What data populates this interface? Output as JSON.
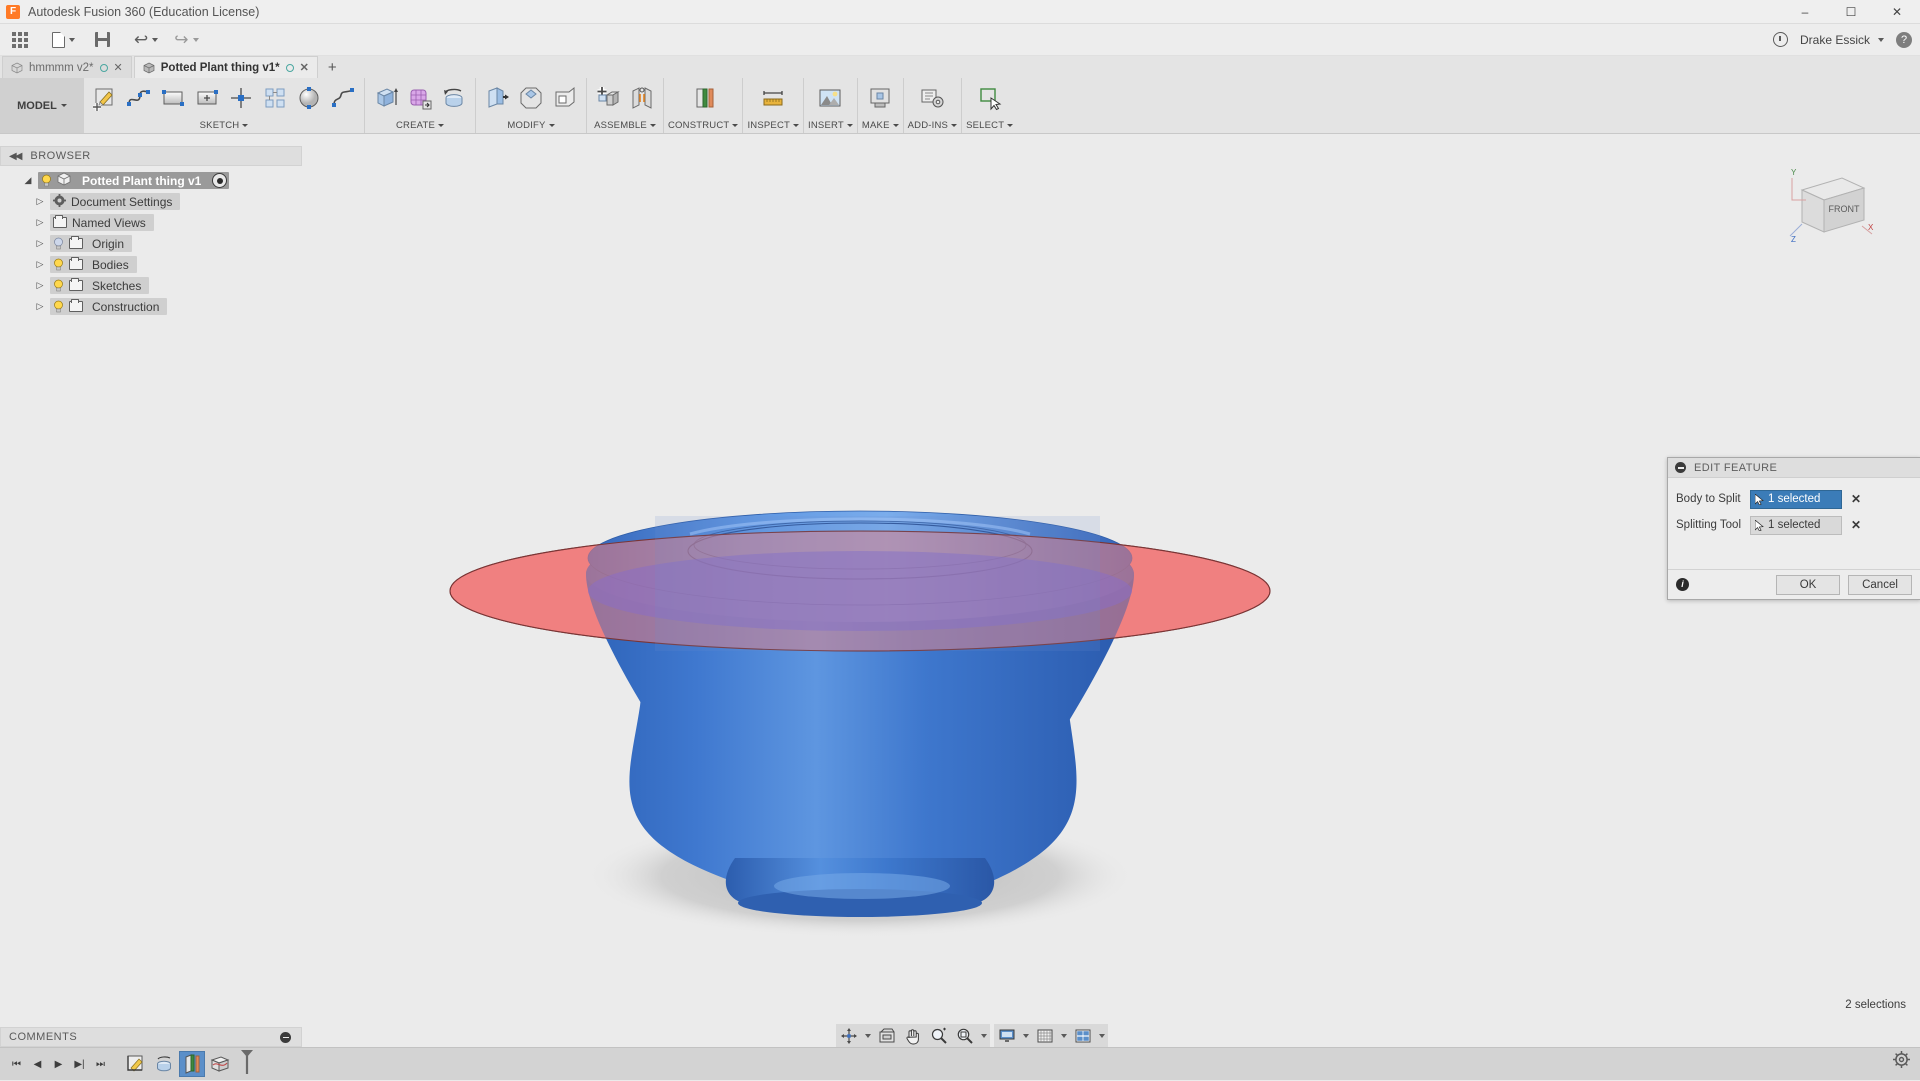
{
  "window": {
    "title": "Autodesk Fusion 360 (Education License)",
    "logo_letter": "F",
    "minimize": "–",
    "maximize": "☐",
    "close": "✕"
  },
  "quick_access": {
    "items": [
      {
        "name": "app-grid-button",
        "label": ""
      },
      {
        "name": "new-file-button",
        "label": ""
      },
      {
        "name": "save-button",
        "label": ""
      },
      {
        "name": "undo-button",
        "label": ""
      },
      {
        "name": "redo-button",
        "label": ""
      }
    ],
    "account_name": "Drake Essick",
    "help_label": "?",
    "recent_label": ""
  },
  "tabs": [
    {
      "label": "hmmmm v2*",
      "active": false,
      "close": "✕"
    },
    {
      "label": "Potted Plant thing v1*",
      "active": true,
      "close": "✕"
    }
  ],
  "new_tab_label": "+",
  "ribbon": {
    "workspace": "MODEL",
    "panels": [
      {
        "label": "SKETCH",
        "has_caret": true,
        "buttons": [
          "create-sketch-icon",
          "spline-icon",
          "rectangle-icon",
          "rectangle-point-icon",
          "construction-line-icon",
          "rectangular-pattern-icon",
          "circle-icon",
          "fit-point-spline-icon"
        ]
      },
      {
        "label": "CREATE",
        "has_caret": true,
        "buttons": [
          "extrude-icon",
          "form-icon",
          "revolve-icon"
        ]
      },
      {
        "label": "MODIFY",
        "has_caret": true,
        "buttons": [
          "press-pull-icon",
          "chamfer-icon",
          "shell-icon"
        ]
      },
      {
        "label": "ASSEMBLE",
        "has_caret": true,
        "buttons": [
          "new-component-icon",
          "joint-icon"
        ]
      },
      {
        "label": "CONSTRUCT",
        "has_caret": true,
        "buttons": [
          "offset-plane-icon"
        ]
      },
      {
        "label": "INSPECT",
        "has_caret": true,
        "buttons": [
          "measure-icon"
        ]
      },
      {
        "label": "INSERT",
        "has_caret": true,
        "buttons": [
          "insert-image-icon"
        ]
      },
      {
        "label": "MAKE",
        "has_caret": true,
        "buttons": [
          "3d-print-icon"
        ]
      },
      {
        "label": "ADD-INS",
        "has_caret": true,
        "buttons": [
          "scripts-addins-icon"
        ]
      },
      {
        "label": "SELECT",
        "has_caret": true,
        "buttons": [
          "select-icon"
        ]
      }
    ]
  },
  "browser": {
    "header": "BROWSER",
    "root": {
      "label": "Potted Plant thing v1",
      "visible": true
    },
    "items": [
      {
        "label": "Document Settings",
        "icon": "gear-icon",
        "has_bulb": false
      },
      {
        "label": "Named Views",
        "icon": "folder-icon",
        "has_bulb": false
      },
      {
        "label": "Origin",
        "icon": "folder-icon",
        "has_bulb": true,
        "bulb_on": false
      },
      {
        "label": "Bodies",
        "icon": "folder-icon",
        "has_bulb": true,
        "bulb_on": true
      },
      {
        "label": "Sketches",
        "icon": "folder-icon",
        "has_bulb": true,
        "bulb_on": true
      },
      {
        "label": "Construction",
        "icon": "folder-icon",
        "has_bulb": true,
        "bulb_on": true
      }
    ]
  },
  "viewcube": {
    "face_label": "FRONT",
    "axis_x": "X",
    "axis_y": "Y",
    "axis_z": "Z"
  },
  "dialog": {
    "title": "EDIT FEATURE",
    "rows": [
      {
        "label": "Body to Split",
        "value": "1 selected",
        "active": true,
        "clear": "✕"
      },
      {
        "label": "Splitting Tool",
        "value": "1 selected",
        "active": false,
        "clear": "✕"
      }
    ],
    "info_glyph": "i",
    "ok_label": "OK",
    "cancel_label": "Cancel"
  },
  "navbar": {
    "buttons": [
      "orbit-icon",
      "look-at-icon",
      "pan-icon",
      "zoom-icon",
      "fit-icon"
    ],
    "display_buttons": [
      "display-settings-icon",
      "grid-snap-icon",
      "viewports-icon"
    ]
  },
  "comments": {
    "header": "COMMENTS"
  },
  "status": {
    "selection_count": "2 selections"
  },
  "timeline": {
    "controls": [
      "go-to-beginning-icon",
      "step-back-icon",
      "play-icon",
      "step-forward-icon",
      "go-to-end-icon"
    ],
    "features": [
      {
        "name": "sketch-feature",
        "selected": false
      },
      {
        "name": "revolve-feature",
        "selected": false
      },
      {
        "name": "split-body-feature",
        "selected": true
      },
      {
        "name": "surface-feature",
        "selected": false
      }
    ],
    "settings_icon": "gear-icon"
  },
  "colors": {
    "accent_blue": "#3b7cb8",
    "body_blue": "#3b6fc4",
    "split_plane_red": "#f08080",
    "chrome_gray": "#ebebeb",
    "selection_highlight": "#5b8fc9"
  },
  "model": {
    "body_name": "potted-plant-body",
    "plane_name": "splitting-tool-surface"
  }
}
